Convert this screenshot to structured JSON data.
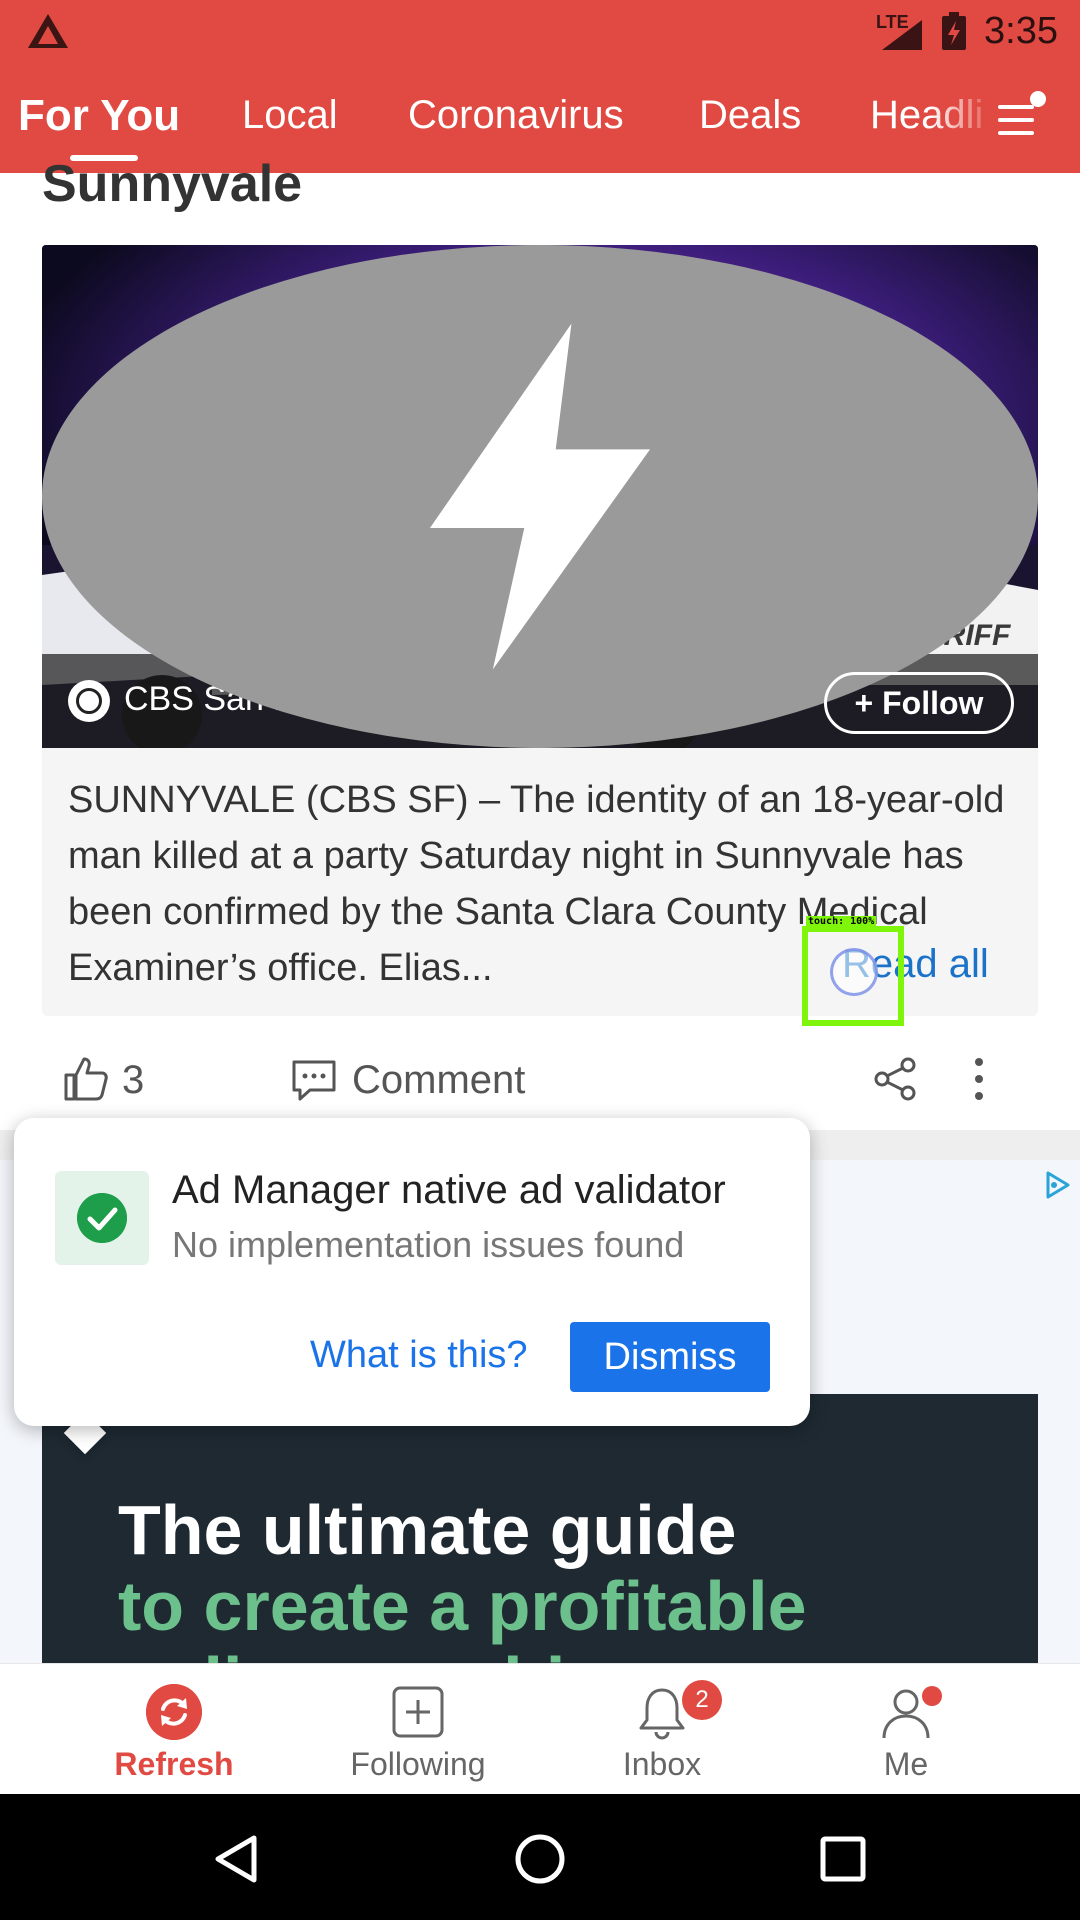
{
  "status_bar": {
    "network": "LTE",
    "time": "3:35",
    "icons": [
      "app-logo-icon",
      "signal-icon",
      "battery-charging-icon"
    ]
  },
  "tabs": [
    {
      "label": "For You",
      "active": true
    },
    {
      "label": "Local",
      "active": false
    },
    {
      "label": "Coronavirus",
      "active": false
    },
    {
      "label": "Deals",
      "active": false
    },
    {
      "label": "Headli",
      "active": false
    }
  ],
  "article": {
    "section_title": "Sunnyvale",
    "source": "CBS San Francisco - 11h",
    "follow_label": "+ Follow",
    "summary": "SUNNYVALE (CBS SF) – The identity of an 18-year-old man killed at a party Saturday night in Sunnyvale has been confirmed by the Santa Clara County Medical Examiner’s office. Elias...",
    "read_all_label": "Read all",
    "likes": "3",
    "comment_label": "Comment"
  },
  "touch_overlay": {
    "label": "touch: 100%"
  },
  "validator_popup": {
    "title": "Ad Manager native ad validator",
    "subtitle": "No implementation issues found",
    "what_label": "What is this?",
    "dismiss_label": "Dismiss"
  },
  "ad": {
    "line1": "The ultimate guide",
    "line2": "to create a profitable",
    "line3": "online coaching"
  },
  "bottom_nav": {
    "refresh": "Refresh",
    "following": "Following",
    "inbox": "Inbox",
    "inbox_badge": "2",
    "me": "Me"
  },
  "colors": {
    "brand_red": "#e14a42",
    "link_blue": "#1a73c8",
    "button_blue": "#1a73e8",
    "check_green": "#1e9e4a",
    "touch_green": "#7ef50a"
  }
}
